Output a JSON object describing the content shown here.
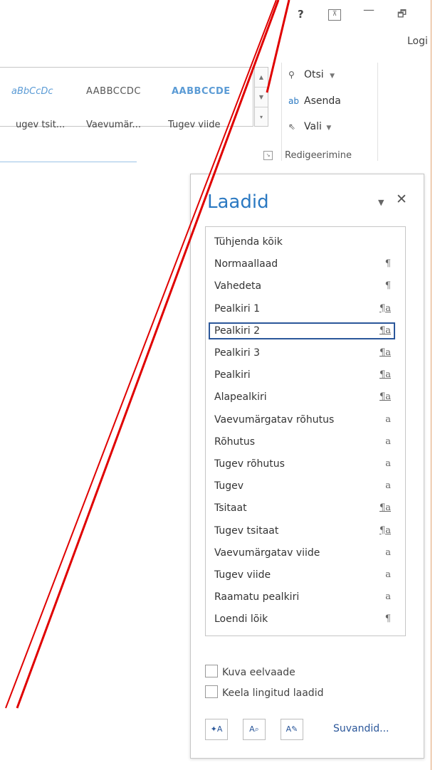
{
  "titlebar": {
    "help": "?",
    "ribbon_options": "⊼",
    "minimize": "—",
    "restore": "🗗",
    "login": "Logi"
  },
  "ribbon": {
    "gallery": {
      "items": [
        {
          "sample": "aBbCcDc",
          "name": "ugev tsit..."
        },
        {
          "sample": "AABBCCDC",
          "name": "Vaevumär..."
        },
        {
          "sample": "AABBCCDE",
          "name": "Tugev viide"
        }
      ]
    },
    "editing": {
      "find": "Otsi",
      "replace": "Asenda",
      "select": "Vali",
      "group_label": "Redigeerimine"
    }
  },
  "styles_pane": {
    "title": "Laadid",
    "items": [
      {
        "label": "Tühjenda kõik",
        "mark": ""
      },
      {
        "label": "Normaallaad",
        "mark": "¶"
      },
      {
        "label": "Vahedeta",
        "mark": "¶"
      },
      {
        "label": "Pealkiri 1",
        "mark": "¶a"
      },
      {
        "label": "Pealkiri 2",
        "mark": "¶a"
      },
      {
        "label": "Pealkiri 3",
        "mark": "¶a"
      },
      {
        "label": "Pealkiri",
        "mark": "¶a"
      },
      {
        "label": "Alapealkiri",
        "mark": "¶a"
      },
      {
        "label": "Vaevumärgatav rõhutus",
        "mark": "a"
      },
      {
        "label": "Rõhutus",
        "mark": "a"
      },
      {
        "label": "Tugev rõhutus",
        "mark": "a"
      },
      {
        "label": "Tugev",
        "mark": "a"
      },
      {
        "label": "Tsitaat",
        "mark": "¶a"
      },
      {
        "label": "Tugev tsitaat",
        "mark": "¶a"
      },
      {
        "label": "Vaevumärgatav viide",
        "mark": "a"
      },
      {
        "label": "Tugev viide",
        "mark": "a"
      },
      {
        "label": "Raamatu pealkiri",
        "mark": "a"
      },
      {
        "label": "Loendi lõik",
        "mark": "¶"
      }
    ],
    "selected_item": "Pealkiri 2",
    "show_preview": "Kuva eelvaade",
    "disable_linked": "Keela lingitud laadid",
    "options": "Suvandid..."
  },
  "colors": {
    "accent": "#2b79c2",
    "selected_border": "#2b579a",
    "annotation": "#e00000",
    "window_border": "#e0a36f"
  }
}
